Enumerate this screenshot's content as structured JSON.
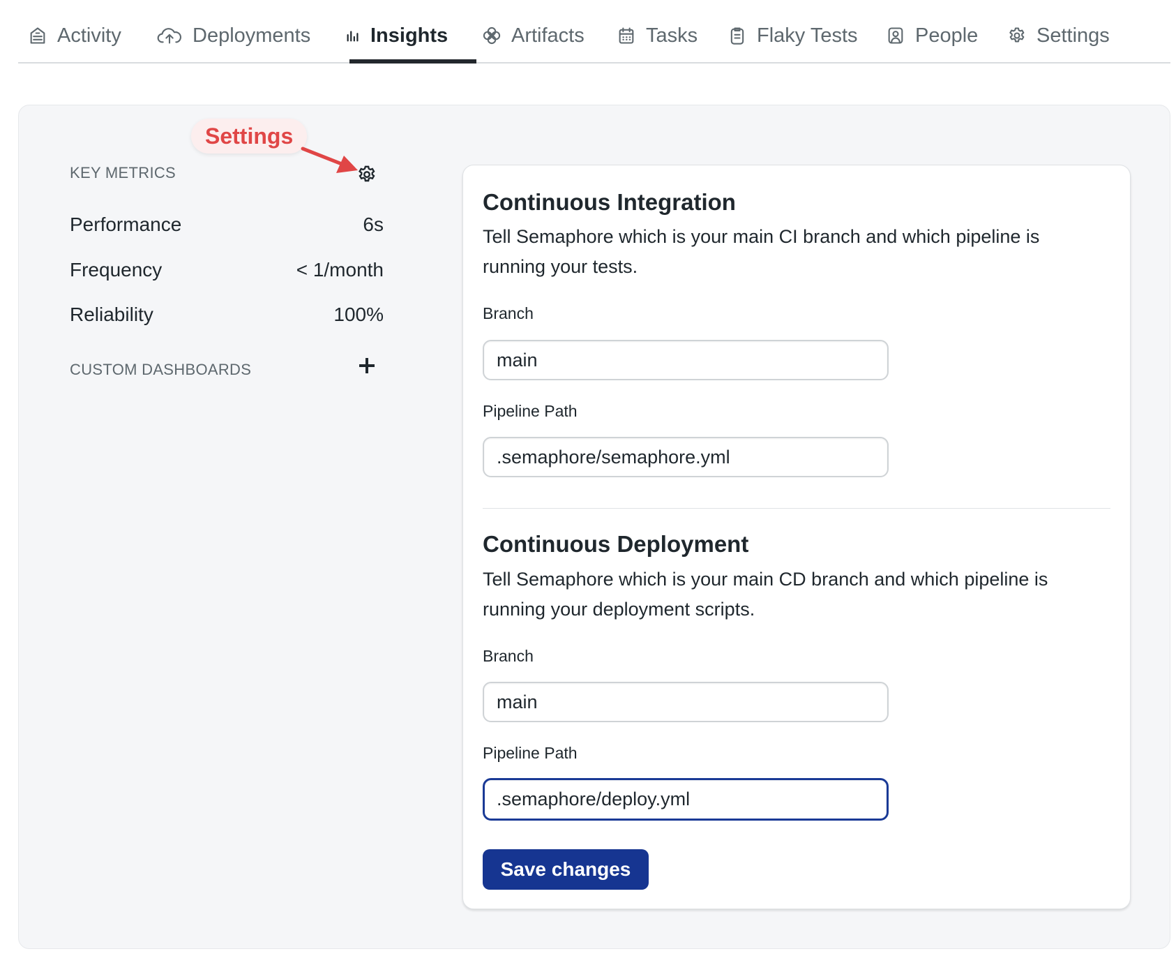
{
  "tabs": [
    {
      "label": "Activity",
      "icon": "activity-icon",
      "active": false
    },
    {
      "label": "Deployments",
      "icon": "cloud-upload-icon",
      "active": false
    },
    {
      "label": "Insights",
      "icon": "bar-chart-icon",
      "active": true
    },
    {
      "label": "Artifacts",
      "icon": "artifacts-icon",
      "active": false
    },
    {
      "label": "Tasks",
      "icon": "calendar-icon",
      "active": false
    },
    {
      "label": "Flaky Tests",
      "icon": "clipboard-icon",
      "active": false
    },
    {
      "label": "People",
      "icon": "person-icon",
      "active": false
    },
    {
      "label": "Settings",
      "icon": "gear-icon",
      "active": false
    }
  ],
  "sidebar": {
    "key_metrics_heading": "KEY METRICS",
    "metrics": [
      {
        "label": "Performance",
        "value": "6s"
      },
      {
        "label": "Frequency",
        "value": "< 1/month"
      },
      {
        "label": "Reliability",
        "value": "100%"
      }
    ],
    "custom_dashboards_heading": "CUSTOM DASHBOARDS"
  },
  "annotation": {
    "label": "Settings",
    "color": "#e04646"
  },
  "ci": {
    "title": "Continuous Integration",
    "description": "Tell Semaphore which is your main CI branch and which pipeline is running your tests.",
    "branch_label": "Branch",
    "branch_value": "main",
    "pipeline_label": "Pipeline Path",
    "pipeline_value": ".semaphore/semaphore.yml"
  },
  "cd": {
    "title": "Continuous Deployment",
    "description": "Tell Semaphore which is your main CD branch and which pipeline is running your deployment scripts.",
    "branch_label": "Branch",
    "branch_value": "main",
    "pipeline_label": "Pipeline Path",
    "pipeline_value": ".semaphore/deploy.yml"
  },
  "save_button_label": "Save changes",
  "colors": {
    "primary": "#163591",
    "focus_border": "#1a3a96",
    "annotation": "#e04646"
  }
}
